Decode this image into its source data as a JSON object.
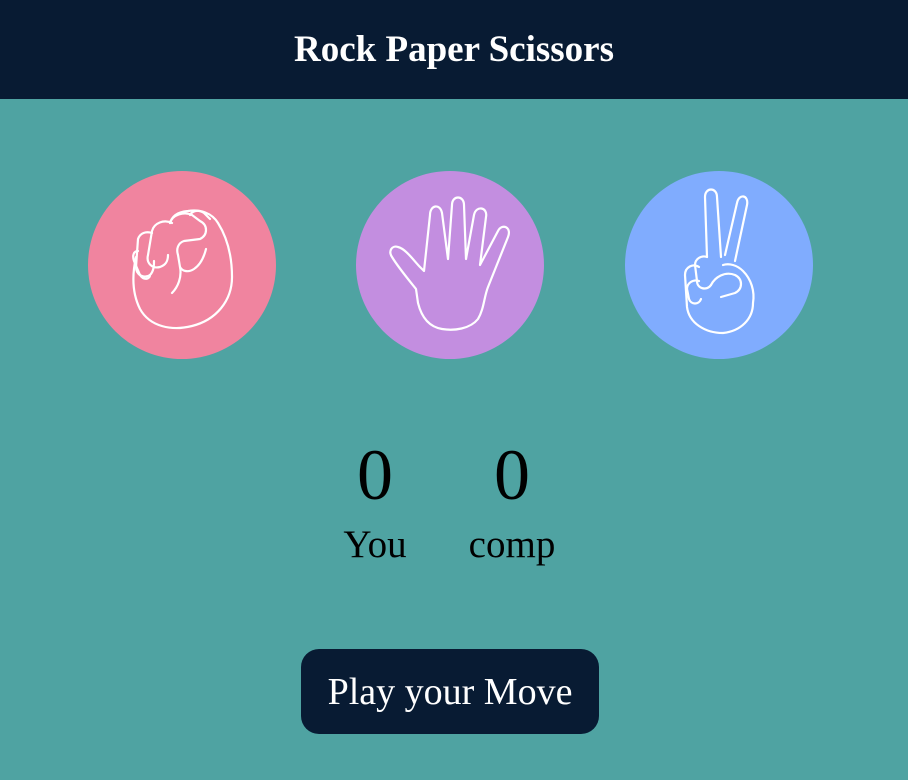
{
  "header": {
    "title": "Rock Paper Scissors"
  },
  "choices": [
    {
      "name": "rock",
      "icon": "rock-fist-icon",
      "color": "#f0849f"
    },
    {
      "name": "paper",
      "icon": "paper-open-hand-icon",
      "color": "#c38ee0"
    },
    {
      "name": "scissors",
      "icon": "scissors-peace-hand-icon",
      "color": "#80acfe"
    }
  ],
  "scoreboard": {
    "user": {
      "score": "0",
      "label": "You"
    },
    "comp": {
      "score": "0",
      "label": "comp"
    }
  },
  "action": {
    "label": "Play your Move"
  },
  "colors": {
    "background": "#4fa3a2",
    "header": "#081b33",
    "button": "#081b33"
  }
}
